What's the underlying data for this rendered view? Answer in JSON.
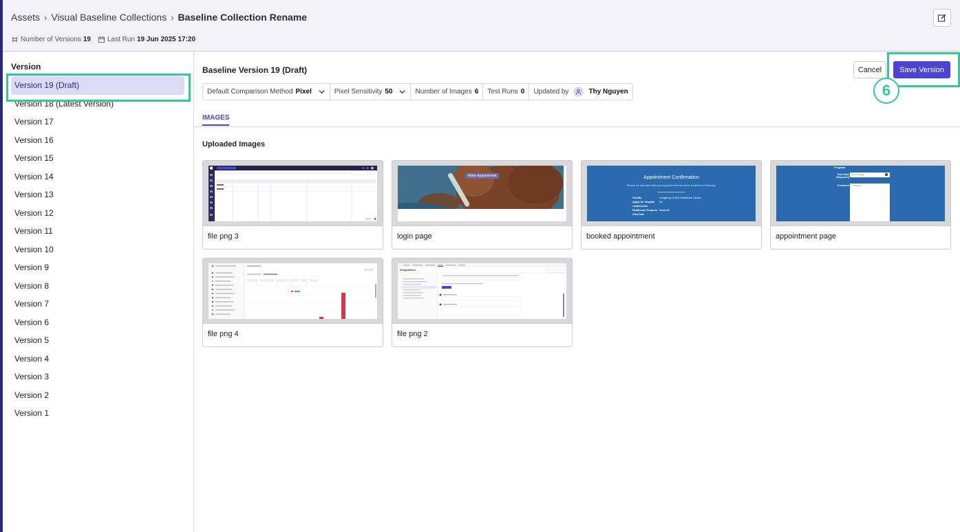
{
  "header": {
    "breadcrumb": [
      "Assets",
      "Visual Baseline Collections",
      "Baseline Collection Rename"
    ],
    "meta": {
      "versions_label": "Number of Versions",
      "versions_value": "19",
      "last_run_label": "Last Run",
      "last_run_value": "19 Jun 2025 17:20"
    }
  },
  "sidebar": {
    "title": "Version",
    "items": [
      "Version 19 (Draft)",
      "Version 18 (Latest Version)",
      "Version 17",
      "Version 16",
      "Version 15",
      "Version 14",
      "Version 13",
      "Version 12",
      "Version 11",
      "Version 10",
      "Version 9",
      "Version 8",
      "Version 7",
      "Version 6",
      "Version 5",
      "Version 4",
      "Version 3",
      "Version 2",
      "Version 1"
    ],
    "selected_index": 0
  },
  "main": {
    "title": "Baseline Version 19 (Draft)",
    "props": {
      "comparison_label": "Default Comparison Method",
      "comparison_value": "Pixel",
      "sensitivity_label": "Pixel Sensitivity",
      "sensitivity_value": "50",
      "images_label": "Number of Images",
      "images_value": "6",
      "runs_label": "Test Runs",
      "runs_value": "0",
      "updated_label": "Updated by",
      "updated_value": "Thy Nguyen"
    },
    "cancel_label": "Cancel",
    "save_label": "Save Version",
    "step_number": "6",
    "tab": "IMAGES",
    "section_title": "Uploaded Images",
    "images": [
      {
        "label": "file png 3",
        "kind": "table-app"
      },
      {
        "label": "login page",
        "kind": "bear-photo",
        "overlay_text": "Make Appointment"
      },
      {
        "label": "booked appointment",
        "kind": "confirmation",
        "heading": "Appointment Confirmation",
        "subtext": "Please be informed that your appointment has been booked as following:",
        "rows": [
          [
            "Facility",
            "Hongkong CURA Healthcare Center"
          ],
          [
            "Apply for hospital readmission",
            "No"
          ],
          [
            "Healthcare Program",
            "Medicaid"
          ],
          [
            "Visit Date",
            ""
          ]
        ]
      },
      {
        "label": "appointment page",
        "kind": "form",
        "fields": [
          "Program",
          "Visit Date (Required)",
          "Comment"
        ],
        "placeholder_date": "dd/mm/yyyy",
        "placeholder_comment": "Comment"
      },
      {
        "label": "file png 4",
        "kind": "bar-app"
      },
      {
        "label": "file png 2",
        "kind": "integrations",
        "heading": "Integrations"
      }
    ]
  },
  "colors": {
    "accent": "#4a43d6",
    "highlight": "#33c69c",
    "selected_bg": "#dcdaf5",
    "thumb_blue": "#2a6bb0"
  }
}
